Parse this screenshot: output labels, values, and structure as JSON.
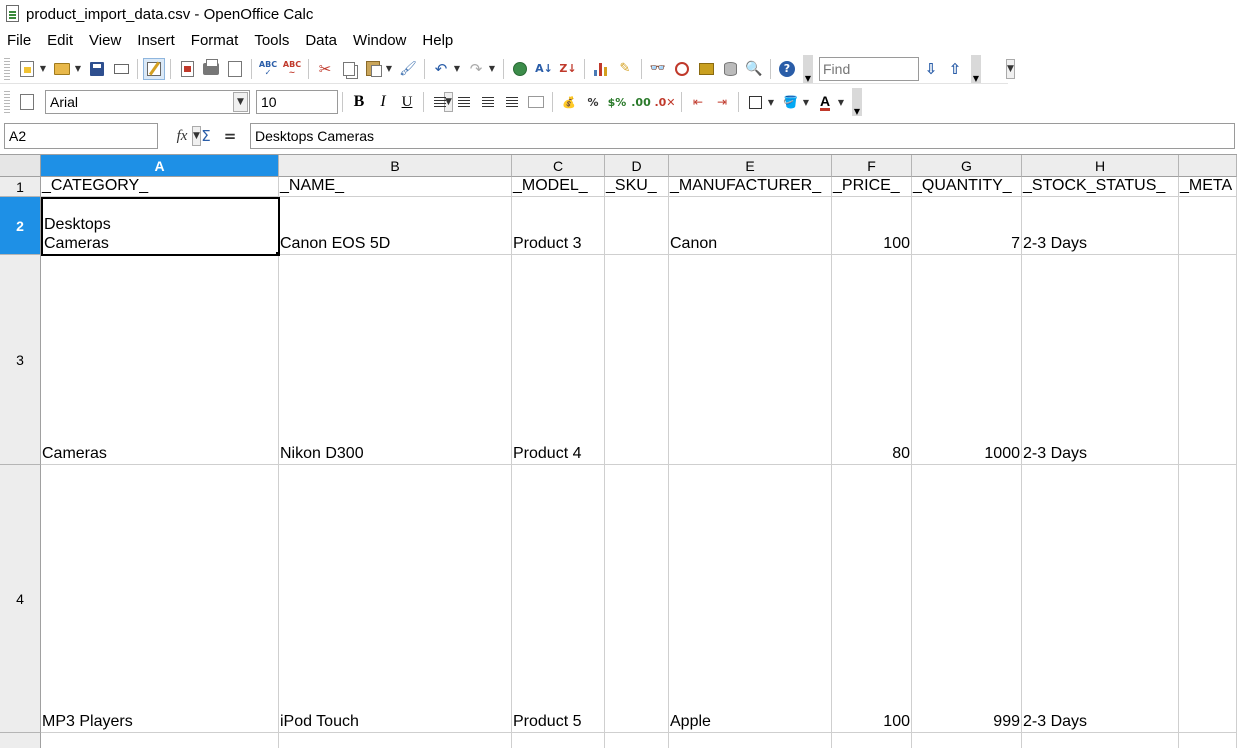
{
  "window": {
    "title": "product_import_data.csv - OpenOffice Calc"
  },
  "menu": [
    "File",
    "Edit",
    "View",
    "Insert",
    "Format",
    "Tools",
    "Data",
    "Window",
    "Help"
  ],
  "toolbar": {
    "find_placeholder": "Find"
  },
  "format": {
    "font_name": "Arial",
    "font_size": "10"
  },
  "formula_bar": {
    "cell_ref": "A2",
    "content": "Desktops Cameras"
  },
  "sheet": {
    "columns": [
      "A",
      "B",
      "C",
      "D",
      "E",
      "F",
      "G",
      "H",
      ""
    ],
    "rows": [
      "1",
      "2",
      "3",
      "4"
    ],
    "selected_cell": "A2",
    "header_row": [
      "_CATEGORY_",
      "_NAME_",
      "_MODEL_",
      "_SKU_",
      "_MANUFACTURER_",
      "_PRICE_",
      "_QUANTITY_",
      "_STOCK_STATUS_",
      "_META"
    ],
    "data": [
      {
        "category_line1": "Desktops",
        "category_line2": "Cameras",
        "name": "Canon EOS 5D",
        "model": "Product 3",
        "sku": "",
        "manufacturer": "Canon",
        "price": "100",
        "quantity": "7",
        "stock_status": "2-3 Days"
      },
      {
        "category_line1": "",
        "category_line2": "Cameras",
        "name": "Nikon D300",
        "model": "Product 4",
        "sku": "",
        "manufacturer": "",
        "price": "80",
        "quantity": "1000",
        "stock_status": "2-3 Days"
      },
      {
        "category_line1": "",
        "category_line2": "MP3 Players",
        "name": "iPod Touch",
        "model": "Product 5",
        "sku": "",
        "manufacturer": "Apple",
        "price": "100",
        "quantity": "999",
        "stock_status": "2-3 Days"
      }
    ]
  },
  "colors": {
    "selection_header": "#1e90e6",
    "header_bg": "#ededed",
    "grid_line": "#cfcfcf"
  }
}
